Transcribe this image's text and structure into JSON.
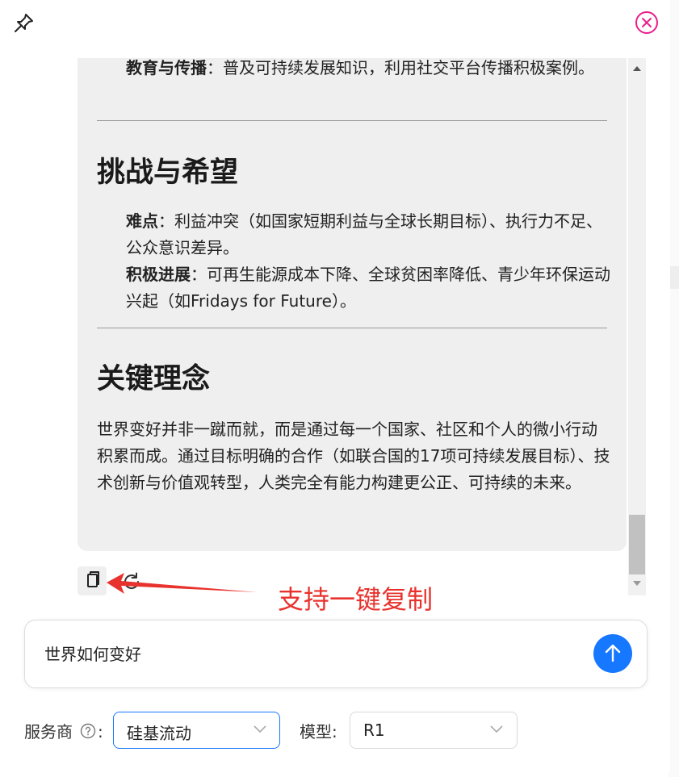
{
  "chat": {
    "item_education": {
      "term": "教育与传播",
      "text": "：普及可持续发展知识，利用社交平台传播积极案例。"
    },
    "section_challenges": {
      "heading": "挑战与希望",
      "items": [
        {
          "term": "难点",
          "text": "：利益冲突（如国家短期利益与全球长期目标）、执行力不足、公众意识差异。"
        },
        {
          "term": "积极进展",
          "text": "：可再生能源成本下降、全球贫困率降低、青少年环保运动兴起（如Fridays for Future）。"
        }
      ]
    },
    "section_key": {
      "heading": "关键理念",
      "paragraph": "世界变好并非一蹴而就，而是通过每一个国家、社区和个人的微小行动积累而成。通过目标明确的合作（如联合国的17项可持续发展目标）、技术创新与价值观转型，人类完全有能力构建更公正、可持续的未来。"
    }
  },
  "annotation": {
    "text": "支持一键复制",
    "color": "#e8322d"
  },
  "input": {
    "value": "世界如何变好"
  },
  "settings": {
    "provider_label": "服务商",
    "provider_colon": ":",
    "provider_value": "硅基流动",
    "model_label": "模型:",
    "model_value": "R1"
  },
  "colors": {
    "accent": "#1677ff",
    "close": "#e91e8c",
    "annotation": "#e8322d"
  },
  "icons": [
    "pin-icon",
    "close-icon",
    "copy-icon",
    "refresh-icon",
    "send-arrow-icon",
    "help-icon",
    "chevron-down-icon"
  ]
}
